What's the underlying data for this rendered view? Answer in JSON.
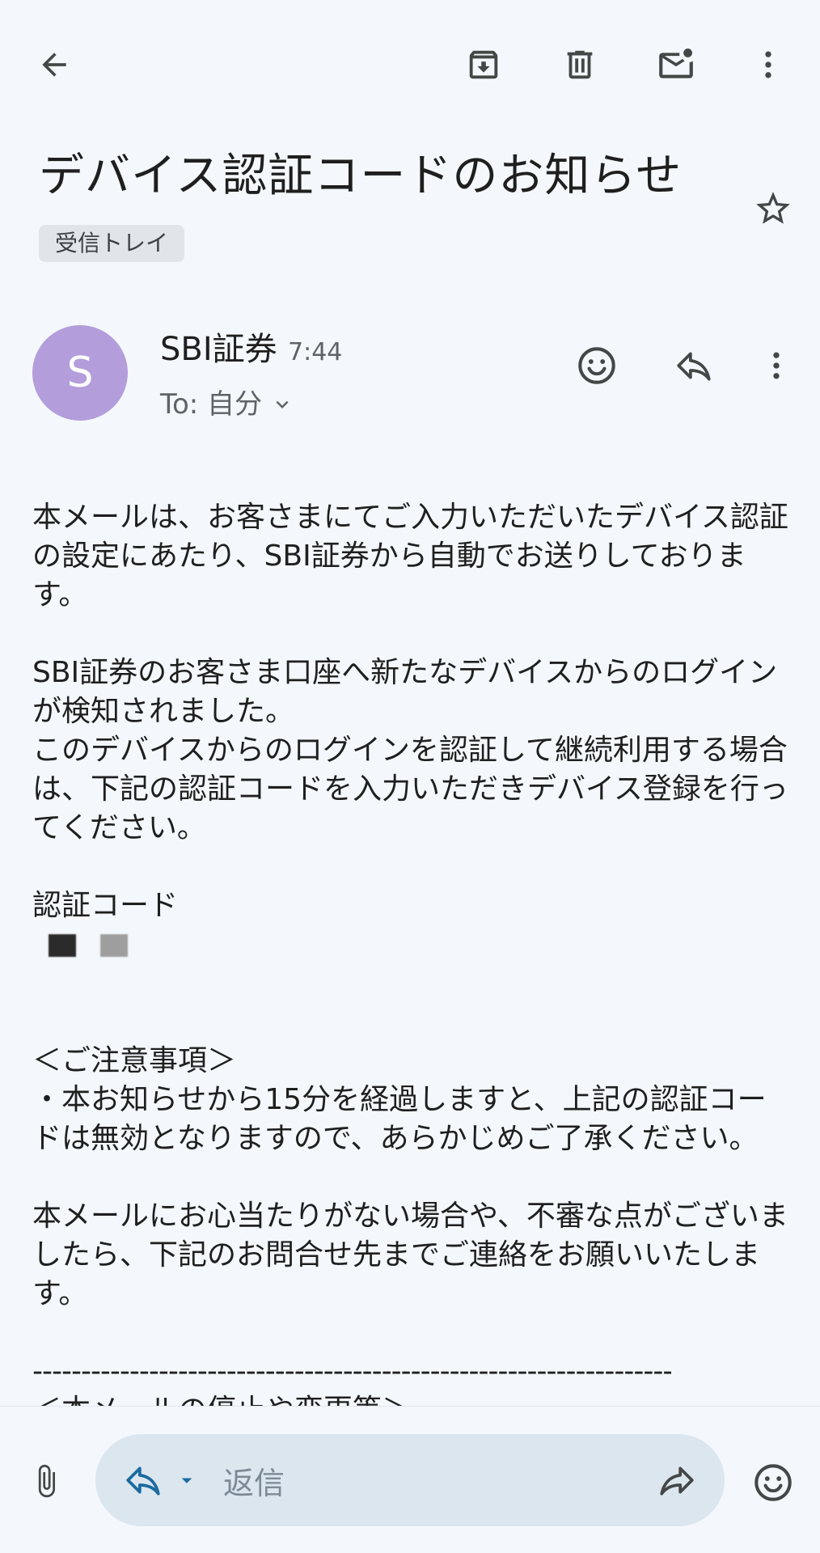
{
  "topbar": {
    "icons": [
      "back-arrow-icon",
      "archive-icon",
      "delete-icon",
      "mark-unread-icon",
      "more-vert-icon"
    ]
  },
  "subject": "デバイス認証コードのお知らせ",
  "label_chip": "受信トレイ",
  "sender": {
    "avatar_letter": "S",
    "avatar_color": "#b39ddb",
    "name": "SBI証券",
    "time": "7:44",
    "recipient": "To: 自分"
  },
  "body": {
    "p1": "本メールは、お客さまにてご入力いただいたデバイス認証の設定にあたり、SBI証券から自動でお送りしております。",
    "p2_line1": "SBI証券のお客さま口座へ新たなデバイスからのログインが検知されました。",
    "p2_line2": "このデバイスからのログインを認証して継続利用する場合は、下記の認証コードを入力いただきデバイス登録を行ってください。",
    "code_label": "認証コード",
    "notice_heading": "＜ご注意事項＞",
    "notice_item": "・本お知らせから15分を経過しますと、上記の認証コードは無効となりますので、あらかじめご了承ください。",
    "p4": "本メールにお心当たりがない場合や、不審な点がございましたら、下記のお問合せ先までご連絡をお願いいたします。",
    "divider": "------------------------------------------------------------------------",
    "cutoff_heading": "＜本メールの停止や変更等＞"
  },
  "bottombar": {
    "reply_placeholder": "返信"
  },
  "colors": {
    "background": "#f4f8fc",
    "reply_pill": "#dbe6ef",
    "icon": "#444746"
  }
}
